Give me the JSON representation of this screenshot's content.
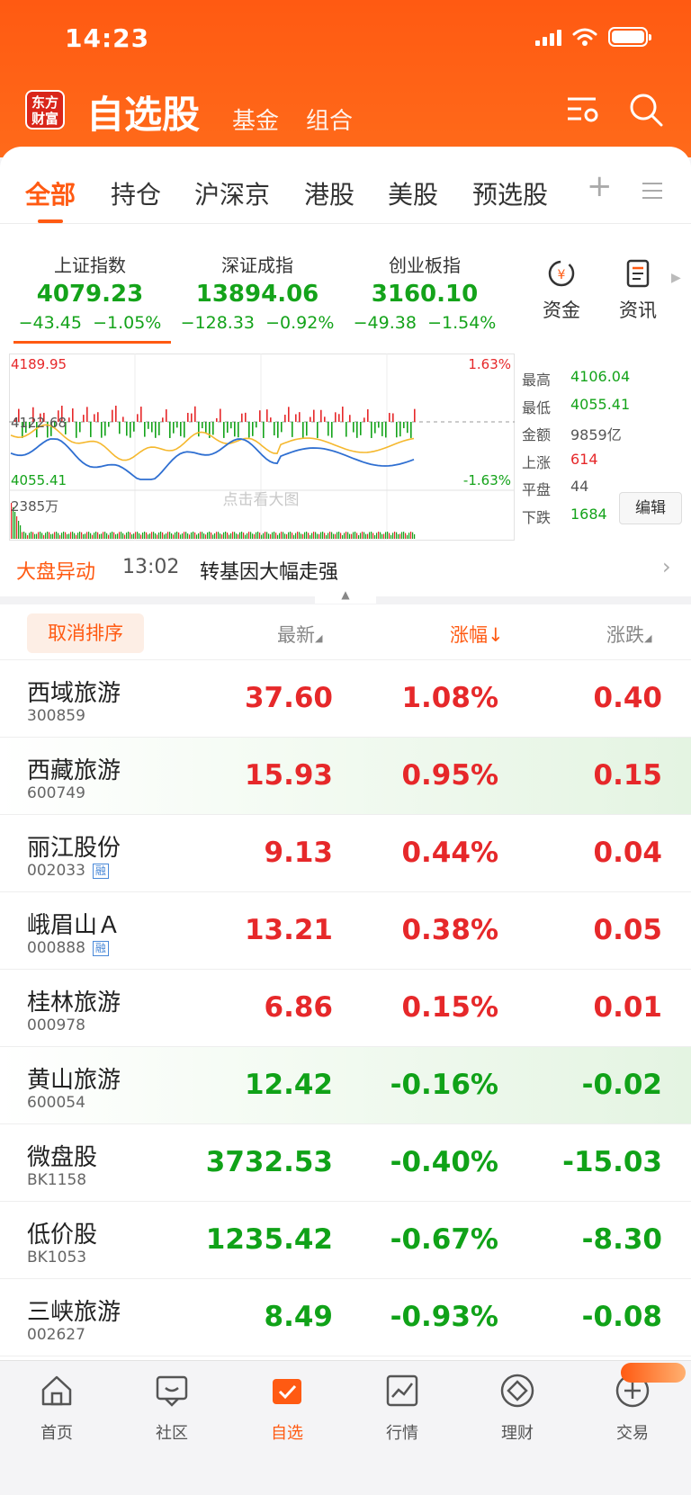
{
  "status": {
    "time": "14:23"
  },
  "header": {
    "logo_line1": "东方",
    "logo_line2": "财富",
    "title": "自选股",
    "tab_fund": "基金",
    "tab_combo": "组合"
  },
  "tabs": [
    "全部",
    "持仓",
    "沪深京",
    "港股",
    "美股",
    "预选股"
  ],
  "indices": [
    {
      "name": "上证指数",
      "value": "4079.23",
      "change": "−43.45",
      "pct": "−1.05%"
    },
    {
      "name": "深证成指",
      "value": "13894.06",
      "change": "−128.33",
      "pct": "−0.92%"
    },
    {
      "name": "创业板指",
      "value": "3160.10",
      "change": "−49.38",
      "pct": "−1.54%"
    }
  ],
  "quick_links": {
    "capital": "资金",
    "news": "资讯"
  },
  "chart_data": {
    "type": "line",
    "y_top_label": "4189.95",
    "y_mid_label": "4122.68",
    "y_bottom_label": "4055.41",
    "pct_top_label": "1.63%",
    "pct_bottom_label": "-1.63%",
    "volume_label": "2385万",
    "overlay_text": "点击看大图",
    "ylim": [
      4055.41,
      4189.95
    ]
  },
  "market_stats": [
    {
      "label": "最高",
      "value": "4106.04",
      "color": "#14a31a"
    },
    {
      "label": "最低",
      "value": "4055.41",
      "color": "#14a31a"
    },
    {
      "label": "金额",
      "value": "9859亿",
      "color": "#555555"
    },
    {
      "label": "上涨",
      "value": "614",
      "color": "#e6282a"
    },
    {
      "label": "平盘",
      "value": "44",
      "color": "#555555"
    },
    {
      "label": "下跌",
      "value": "1684",
      "color": "#14a31a"
    }
  ],
  "edit_label": "编辑",
  "alert": {
    "tag": "大盘异动",
    "time": "13:02",
    "text": "转基因大幅走强"
  },
  "list_header": {
    "sort_button": "取消排序",
    "latest": "最新",
    "change_pct": "涨幅",
    "change": "涨跌"
  },
  "stocks": [
    {
      "name": "西域旅游",
      "code": "300859",
      "price": "37.60",
      "pct": "1.08%",
      "chg": "0.40",
      "dir": "up",
      "rong": ""
    },
    {
      "name": "西藏旅游",
      "code": "600749",
      "price": "15.93",
      "pct": "0.95%",
      "chg": "0.15",
      "dir": "up",
      "rong": "",
      "hl": true
    },
    {
      "name": "丽江股份",
      "code": "002033",
      "price": "9.13",
      "pct": "0.44%",
      "chg": "0.04",
      "dir": "up",
      "rong": "融"
    },
    {
      "name": "峨眉山Ａ",
      "code": "000888",
      "price": "13.21",
      "pct": "0.38%",
      "chg": "0.05",
      "dir": "up",
      "rong": "融"
    },
    {
      "name": "桂林旅游",
      "code": "000978",
      "price": "6.86",
      "pct": "0.15%",
      "chg": "0.01",
      "dir": "up",
      "rong": ""
    },
    {
      "name": "黄山旅游",
      "code": "600054",
      "price": "12.42",
      "pct": "-0.16%",
      "chg": "-0.02",
      "dir": "down",
      "rong": "",
      "hl": true
    },
    {
      "name": "微盘股",
      "code": "BK1158",
      "price": "3732.53",
      "pct": "-0.40%",
      "chg": "-15.03",
      "dir": "down",
      "rong": ""
    },
    {
      "name": "低价股",
      "code": "BK1053",
      "price": "1235.42",
      "pct": "-0.67%",
      "chg": "-8.30",
      "dir": "down",
      "rong": ""
    },
    {
      "name": "三峡旅游",
      "code": "002627",
      "price": "8.49",
      "pct": "-0.93%",
      "chg": "-0.08",
      "dir": "down",
      "rong": ""
    }
  ],
  "bottom_nav": [
    "首页",
    "社区",
    "自选",
    "行情",
    "理财",
    "交易"
  ],
  "colors": {
    "brand": "#ff5a12",
    "up": "#e6282a",
    "down": "#10a218"
  }
}
